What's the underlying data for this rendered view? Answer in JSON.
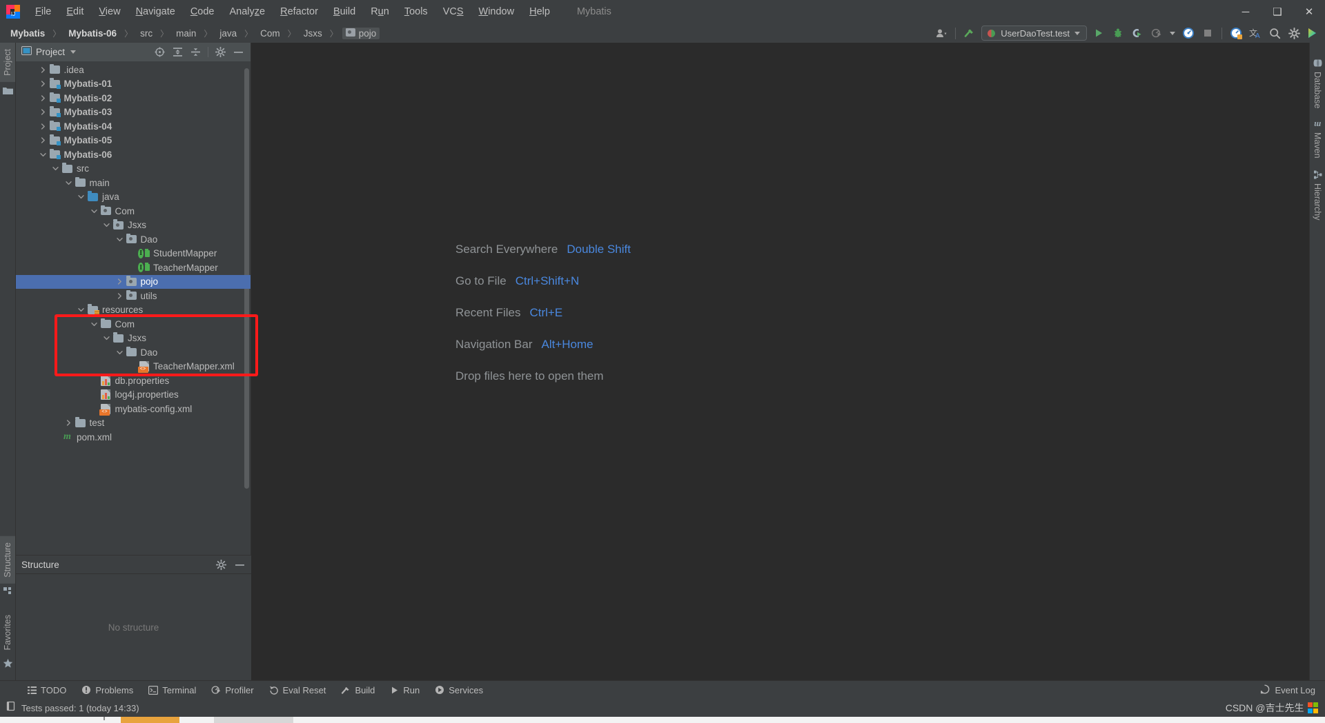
{
  "window": {
    "title": "Mybatis",
    "controls": {
      "minimize": "─",
      "maximize": "❑",
      "close": "✕"
    }
  },
  "menubar": {
    "items": [
      {
        "label": "File",
        "mnemonic": "F"
      },
      {
        "label": "Edit",
        "mnemonic": "E"
      },
      {
        "label": "View",
        "mnemonic": "V"
      },
      {
        "label": "Navigate",
        "mnemonic": "N"
      },
      {
        "label": "Code",
        "mnemonic": "C"
      },
      {
        "label": "Analyze",
        "mnemonic": "z"
      },
      {
        "label": "Refactor",
        "mnemonic": "R"
      },
      {
        "label": "Build",
        "mnemonic": "B"
      },
      {
        "label": "Run",
        "mnemonic": "u"
      },
      {
        "label": "Tools",
        "mnemonic": "T"
      },
      {
        "label": "VCS",
        "mnemonic": "S"
      },
      {
        "label": "Window",
        "mnemonic": "W"
      },
      {
        "label": "Help",
        "mnemonic": "H"
      }
    ]
  },
  "breadcrumb": {
    "items": [
      {
        "label": "Mybatis",
        "bold": true,
        "icon": "none",
        "selected": false
      },
      {
        "label": "Mybatis-06",
        "bold": true,
        "icon": "none",
        "selected": false
      },
      {
        "label": "src",
        "bold": false,
        "icon": "none",
        "selected": false
      },
      {
        "label": "main",
        "bold": false,
        "icon": "none",
        "selected": false
      },
      {
        "label": "java",
        "bold": false,
        "icon": "none",
        "selected": false
      },
      {
        "label": "Com",
        "bold": false,
        "icon": "none",
        "selected": false
      },
      {
        "label": "Jsxs",
        "bold": false,
        "icon": "none",
        "selected": false
      },
      {
        "label": "pojo",
        "bold": false,
        "icon": "package",
        "selected": true
      }
    ],
    "separator": "〉"
  },
  "toolbar": {
    "run_config": {
      "name": "UserDaoTest.test",
      "icon": "junit-icon"
    },
    "buttons": [
      {
        "name": "user-settings-icon",
        "glyph": "person"
      },
      {
        "name": "build-hammer-icon",
        "glyph": "hammer"
      },
      {
        "name": "run-button",
        "glyph": "play"
      },
      {
        "name": "debug-button",
        "glyph": "bug"
      },
      {
        "name": "run-with-coverage-button",
        "glyph": "coverage"
      },
      {
        "name": "profile-button",
        "glyph": "profile"
      },
      {
        "name": "profiler-dropdown-caret",
        "glyph": "caret"
      },
      {
        "name": "attach-profiler-icon",
        "glyph": "gauge"
      },
      {
        "name": "stop-button",
        "glyph": "stop"
      },
      {
        "name": "updating-gauge-icon",
        "glyph": "gauge2"
      },
      {
        "name": "translate-icon",
        "glyph": "translate"
      },
      {
        "name": "search-everywhere-icon",
        "glyph": "search"
      },
      {
        "name": "settings-gear-icon",
        "glyph": "gear"
      },
      {
        "name": "ide-brand-icon",
        "glyph": "brand"
      }
    ]
  },
  "left_edge_tabs": [
    {
      "label": "Project",
      "icon": "project-icon",
      "active": true
    }
  ],
  "left_bottom_tabs": [
    {
      "label": "Structure",
      "icon": "structure-icon",
      "active": true
    },
    {
      "label": "Favorites",
      "icon": "star-icon",
      "active": false
    }
  ],
  "right_edge_tabs": [
    {
      "label": "Database",
      "icon": "database-icon"
    },
    {
      "label": "Maven",
      "icon": "maven-icon"
    },
    {
      "label": "Hierarchy",
      "icon": "hierarchy-icon"
    }
  ],
  "project_panel": {
    "title": "Project",
    "title_icon": "project-view-icon",
    "tools": [
      {
        "name": "select-opened-file-icon"
      },
      {
        "name": "expand-all-icon"
      },
      {
        "name": "collapse-all-icon"
      },
      {
        "name": "panel-settings-gear-icon"
      },
      {
        "name": "hide-panel-icon"
      }
    ],
    "tree": [
      {
        "label": ".idea",
        "depth": 1,
        "arrow": "right",
        "icon": "folder",
        "bold": false,
        "selected": false
      },
      {
        "label": "Mybatis-01",
        "depth": 1,
        "arrow": "right",
        "icon": "folder-module",
        "bold": true,
        "selected": false
      },
      {
        "label": "Mybatis-02",
        "depth": 1,
        "arrow": "right",
        "icon": "folder-module",
        "bold": true,
        "selected": false
      },
      {
        "label": "Mybatis-03",
        "depth": 1,
        "arrow": "right",
        "icon": "folder-module",
        "bold": true,
        "selected": false
      },
      {
        "label": "Mybatis-04",
        "depth": 1,
        "arrow": "right",
        "icon": "folder-module",
        "bold": true,
        "selected": false
      },
      {
        "label": "Mybatis-05",
        "depth": 1,
        "arrow": "right",
        "icon": "folder-module",
        "bold": true,
        "selected": false
      },
      {
        "label": "Mybatis-06",
        "depth": 1,
        "arrow": "down",
        "icon": "folder-module",
        "bold": true,
        "selected": false
      },
      {
        "label": "src",
        "depth": 2,
        "arrow": "down",
        "icon": "folder",
        "bold": false,
        "selected": false
      },
      {
        "label": "main",
        "depth": 3,
        "arrow": "down",
        "icon": "folder",
        "bold": false,
        "selected": false
      },
      {
        "label": "java",
        "depth": 4,
        "arrow": "down",
        "icon": "folder-source",
        "bold": false,
        "selected": false
      },
      {
        "label": "Com",
        "depth": 5,
        "arrow": "down",
        "icon": "folder-package",
        "bold": false,
        "selected": false
      },
      {
        "label": "Jsxs",
        "depth": 6,
        "arrow": "down",
        "icon": "folder-package",
        "bold": false,
        "selected": false
      },
      {
        "label": "Dao",
        "depth": 7,
        "arrow": "down",
        "icon": "folder-package",
        "bold": false,
        "selected": false
      },
      {
        "label": "StudentMapper",
        "depth": 8,
        "arrow": "none",
        "icon": "interface-mapper",
        "bold": false,
        "selected": false
      },
      {
        "label": "TeacherMapper",
        "depth": 8,
        "arrow": "none",
        "icon": "interface-mapper",
        "bold": false,
        "selected": false
      },
      {
        "label": "pojo",
        "depth": 7,
        "arrow": "right",
        "icon": "folder-package",
        "bold": false,
        "selected": true
      },
      {
        "label": "utils",
        "depth": 7,
        "arrow": "right",
        "icon": "folder-package",
        "bold": false,
        "selected": false
      },
      {
        "label": "resources",
        "depth": 4,
        "arrow": "down",
        "icon": "folder-resources",
        "bold": false,
        "selected": false
      },
      {
        "label": "Com",
        "depth": 5,
        "arrow": "down",
        "icon": "folder",
        "bold": false,
        "selected": false
      },
      {
        "label": "Jsxs",
        "depth": 6,
        "arrow": "down",
        "icon": "folder",
        "bold": false,
        "selected": false
      },
      {
        "label": "Dao",
        "depth": 7,
        "arrow": "down",
        "icon": "folder",
        "bold": false,
        "selected": false
      },
      {
        "label": "TeacherMapper.xml",
        "depth": 8,
        "arrow": "none",
        "icon": "xml-file",
        "bold": false,
        "selected": false
      },
      {
        "label": "db.properties",
        "depth": 5,
        "arrow": "none",
        "icon": "properties-file",
        "bold": false,
        "selected": false
      },
      {
        "label": "log4j.properties",
        "depth": 5,
        "arrow": "none",
        "icon": "properties-file",
        "bold": false,
        "selected": false
      },
      {
        "label": "mybatis-config.xml",
        "depth": 5,
        "arrow": "none",
        "icon": "xml-file",
        "bold": false,
        "selected": false
      },
      {
        "label": "test",
        "depth": 3,
        "arrow": "right",
        "icon": "folder",
        "bold": false,
        "selected": false
      },
      {
        "label": "pom.xml",
        "depth": 2,
        "arrow": "none",
        "icon": "maven-file",
        "bold": false,
        "selected": false
      }
    ]
  },
  "structure_panel": {
    "title": "Structure",
    "empty_text": "No structure",
    "tools": [
      {
        "name": "structure-settings-gear-icon"
      },
      {
        "name": "structure-hide-icon"
      }
    ]
  },
  "editor": {
    "shortcuts": [
      {
        "action": "Search Everywhere",
        "key": "Double Shift"
      },
      {
        "action": "Go to File",
        "key": "Ctrl+Shift+N"
      },
      {
        "action": "Recent Files",
        "key": "Ctrl+E"
      },
      {
        "action": "Navigation Bar",
        "key": "Alt+Home"
      }
    ],
    "drop_hint": "Drop files here to open them"
  },
  "bottom_strip": {
    "items": [
      {
        "label": "TODO",
        "icon": "todo-icon"
      },
      {
        "label": "Problems",
        "icon": "problems-icon"
      },
      {
        "label": "Terminal",
        "icon": "terminal-icon"
      },
      {
        "label": "Profiler",
        "icon": "profiler-icon"
      },
      {
        "label": "Eval Reset",
        "icon": "eval-reset-icon"
      },
      {
        "label": "Build",
        "icon": "build-icon"
      },
      {
        "label": "Run",
        "icon": "run-icon"
      },
      {
        "label": "Services",
        "icon": "services-icon"
      }
    ],
    "event_log": {
      "label": "Event Log",
      "icon": "event-log-icon"
    }
  },
  "status_bar": {
    "message": "Tests passed: 1 (today 14:33)",
    "icon": "test-results-icon",
    "watermark": "CSDN @吉士先生"
  },
  "annotation": {
    "red_box": {
      "color": "#ff1a1a"
    }
  },
  "colors": {
    "accent_blue": "#4b6eaf",
    "link_blue": "#4a88df",
    "panel_bg": "#3c3f41",
    "editor_bg": "#2b2b2b",
    "header_bg": "#4b5052"
  }
}
